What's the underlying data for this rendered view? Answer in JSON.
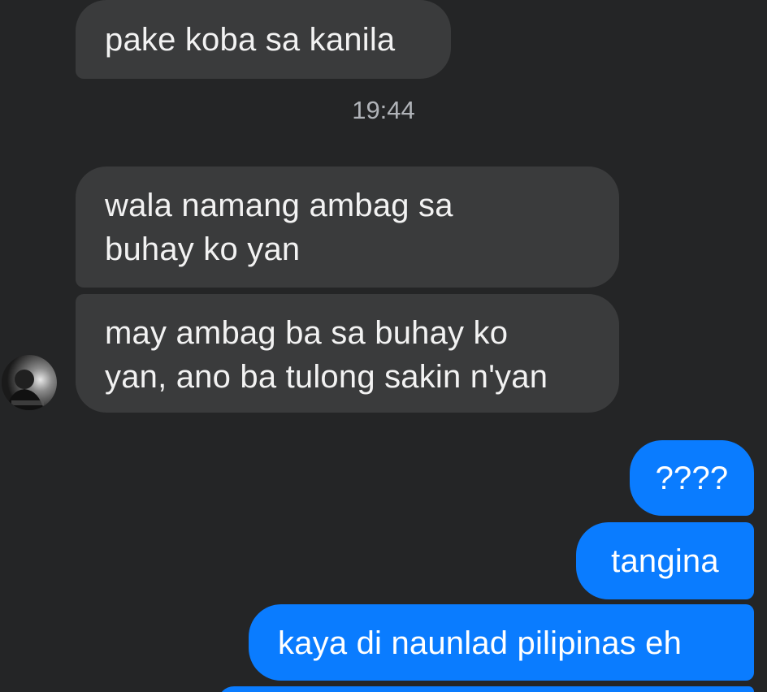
{
  "conversation": {
    "messages_received": [
      {
        "text": "pake koba sa kanila"
      },
      {
        "text": "wala namang ambag sa\nbuhay ko yan"
      },
      {
        "text": "may ambag ba sa buhay ko\nyan, ano ba tulong sakin n'yan"
      }
    ],
    "timestamp": "19:44",
    "messages_sent": [
      {
        "text": "????"
      },
      {
        "text": "tangina"
      },
      {
        "text": "kaya di naunlad pilipinas eh"
      },
      {
        "text": ""
      }
    ]
  },
  "colors": {
    "background": "#242526",
    "received_bubble": "#3a3b3c",
    "sent_bubble": "#0a7cff",
    "timestamp_text": "#b0b3b8"
  },
  "icons": {
    "contact_avatar": "avatar-icon"
  }
}
